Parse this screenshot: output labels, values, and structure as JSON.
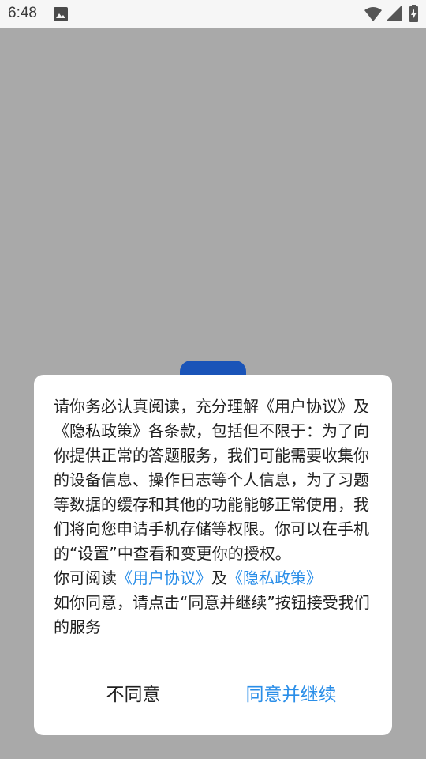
{
  "status_bar": {
    "time": "6:48",
    "icons": [
      "gallery-icon",
      "wifi-icon",
      "signal-icon",
      "battery-charging-icon"
    ]
  },
  "dialog": {
    "paragraph1": "请你务必认真阅读，充分理解《用户协议》及《隐私政策》各条款，包括但不限于：为了向你提供正常的答题服务，我们可能需要收集你的设备信息、操作日志等个人信息，为了习题等数据的缓存和其他的功能能够正常使用，我们将向您申请手机存储等权限。你可以在手机的“设置”中查看和变更你的授权。",
    "read_prefix": "你可阅读",
    "user_agreement_link": "《用户协议》",
    "and_text": "及",
    "privacy_policy_link": "《隐私政策》",
    "paragraph3": "如你同意，请点击“同意并继续”按钮接受我们的服务",
    "disagree_label": "不同意",
    "agree_label": "同意并继续"
  },
  "colors": {
    "overlay": "#a9a9a9",
    "link": "#2a8ee8",
    "tab_blue": "#1a54b8"
  }
}
